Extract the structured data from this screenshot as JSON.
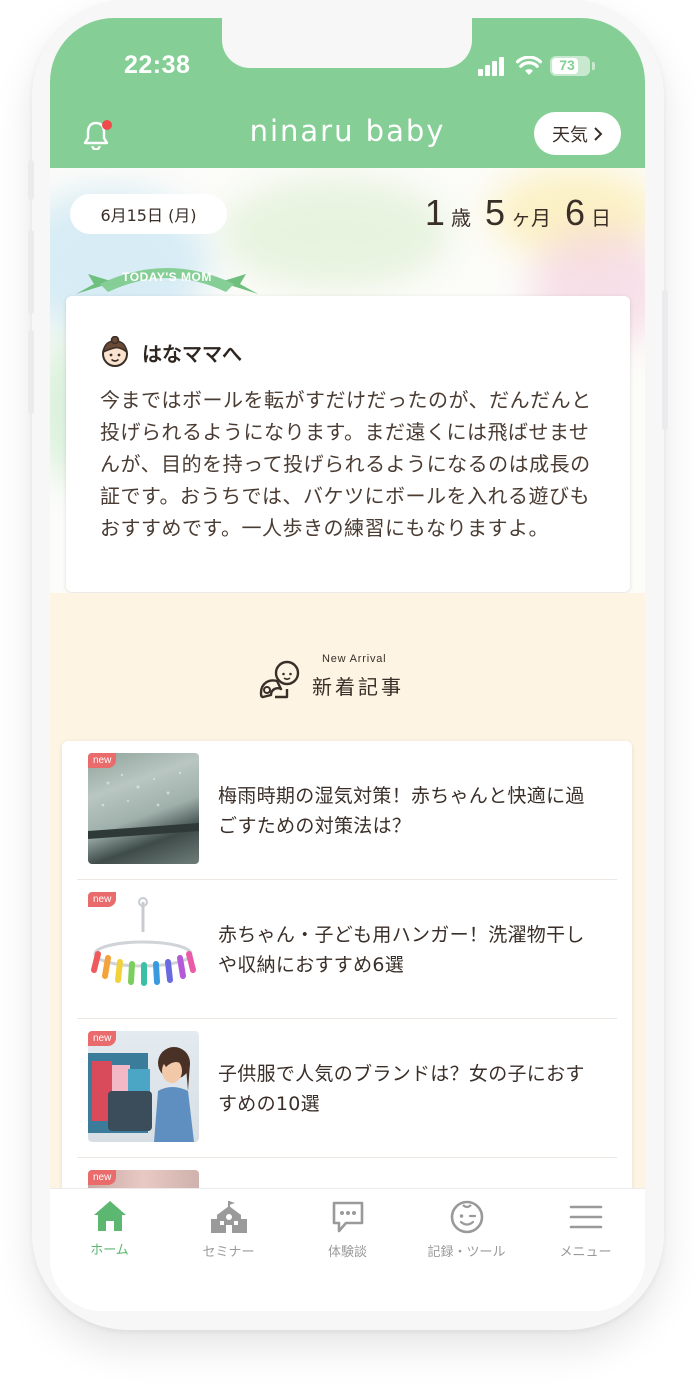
{
  "status_bar": {
    "time": "22:38",
    "battery": "73",
    "battery_level": 0.73
  },
  "header": {
    "logo": "ninaru baby",
    "weather_button": "天気",
    "notification_icon": "bell-icon"
  },
  "hero": {
    "date": "6月15日 (月)",
    "age": {
      "years": "1",
      "years_unit": "歳",
      "months": "5",
      "months_unit": "ヶ月",
      "days": "6",
      "days_unit": "日"
    },
    "ribbon": "TODAY'S MOM",
    "message_title": "はなママへ",
    "message_body": "今まではボールを転がすだけだったのが、だんだんと投げられるようになります。まだ遠くには飛ばせませんが、目的を持って投げられるようになるのは成長の証です。おうちでは、バケツにボールを入れる遊びもおすすめです。一人歩きの練習にもなりますよ。"
  },
  "arrivals": {
    "subtitle": "New Arrival",
    "title": "新着記事",
    "badge": "new",
    "items": [
      {
        "title": "梅雨時期の湿気対策！赤ちゃんと快適に過ごすための対策法は？"
      },
      {
        "title": "赤ちゃん・子ども用ハンガー！洗濯物干しや収納におすすめ6選"
      },
      {
        "title": "子供服で人気のブランドは？女の子におすすめの10選"
      },
      {
        "title": ""
      }
    ]
  },
  "tabbar": {
    "items": [
      {
        "label": "ホーム",
        "icon": "home-icon",
        "active": true
      },
      {
        "label": "セミナー",
        "icon": "school-icon",
        "active": false
      },
      {
        "label": "体験談",
        "icon": "chat-bubble-icon",
        "active": false
      },
      {
        "label": "記録・ツール",
        "icon": "baby-face-icon",
        "active": false
      },
      {
        "label": "メニュー",
        "icon": "menu-icon",
        "active": false
      }
    ]
  },
  "colors": {
    "brand_green": "#85cf96",
    "accent_green": "#5cb870",
    "cream": "#fdf4e3",
    "badge_red": "#ea6b6b"
  }
}
